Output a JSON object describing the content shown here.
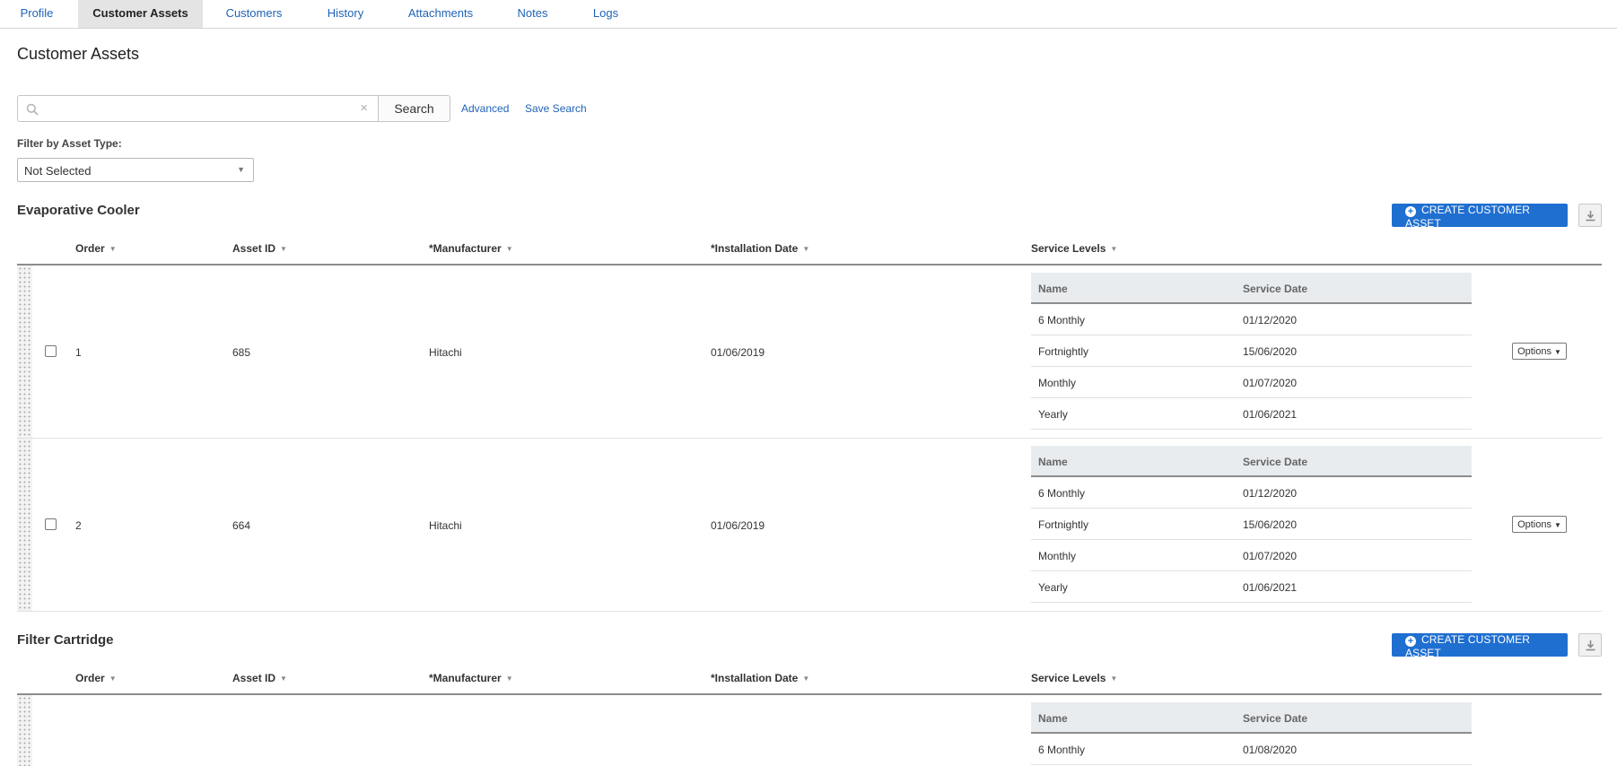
{
  "tabs": [
    {
      "label": "Profile",
      "active": false
    },
    {
      "label": "Customer Assets",
      "active": true
    },
    {
      "label": "Customers",
      "active": false
    },
    {
      "label": "History",
      "active": false
    },
    {
      "label": "Attachments",
      "active": false
    },
    {
      "label": "Notes",
      "active": false
    },
    {
      "label": "Logs",
      "active": false
    }
  ],
  "page": {
    "title": "Customer Assets"
  },
  "search": {
    "value": "",
    "placeholder": "",
    "clear_glyph": "×",
    "button_label": "Search",
    "advanced_label": "Advanced",
    "save_label": "Save Search"
  },
  "filter": {
    "label": "Filter by Asset Type:",
    "selected": "Not Selected"
  },
  "columns": {
    "order": "Order",
    "asset_id": "Asset ID",
    "manufacturer": "*Manufacturer",
    "installation_date": "*Installation Date",
    "service_levels": "Service Levels"
  },
  "subtable_columns": {
    "name": "Name",
    "service_date": "Service Date"
  },
  "create_button_label": "CREATE CUSTOMER ASSET",
  "options_label": "Options",
  "sections": [
    {
      "title": "Evaporative Cooler",
      "rows": [
        {
          "order": "1",
          "asset_id": "685",
          "manufacturer": "Hitachi",
          "installation_date": "01/06/2019",
          "service_levels": [
            {
              "name": "6 Monthly",
              "date": "01/12/2020"
            },
            {
              "name": "Fortnightly",
              "date": "15/06/2020"
            },
            {
              "name": "Monthly",
              "date": "01/07/2020"
            },
            {
              "name": "Yearly",
              "date": "01/06/2021"
            }
          ]
        },
        {
          "order": "2",
          "asset_id": "664",
          "manufacturer": "Hitachi",
          "installation_date": "01/06/2019",
          "service_levels": [
            {
              "name": "6 Monthly",
              "date": "01/12/2020"
            },
            {
              "name": "Fortnightly",
              "date": "15/06/2020"
            },
            {
              "name": "Monthly",
              "date": "01/07/2020"
            },
            {
              "name": "Yearly",
              "date": "01/06/2021"
            }
          ]
        }
      ]
    },
    {
      "title": "Filter Cartridge",
      "rows": [
        {
          "order": "",
          "asset_id": "",
          "manufacturer": "",
          "installation_date": "",
          "service_levels": [
            {
              "name": "6 Monthly",
              "date": "01/08/2020"
            }
          ]
        }
      ]
    }
  ],
  "colors": {
    "accent": "#1f6fd0",
    "link": "#1f63b8",
    "active_tab_bg": "#e4e4e4"
  },
  "icons": {
    "search": "search-icon",
    "clear": "clear-icon",
    "plus": "plus-circle-icon",
    "download": "download-icon",
    "sort": "sort-down-icon",
    "drag": "drag-handle-icon"
  }
}
